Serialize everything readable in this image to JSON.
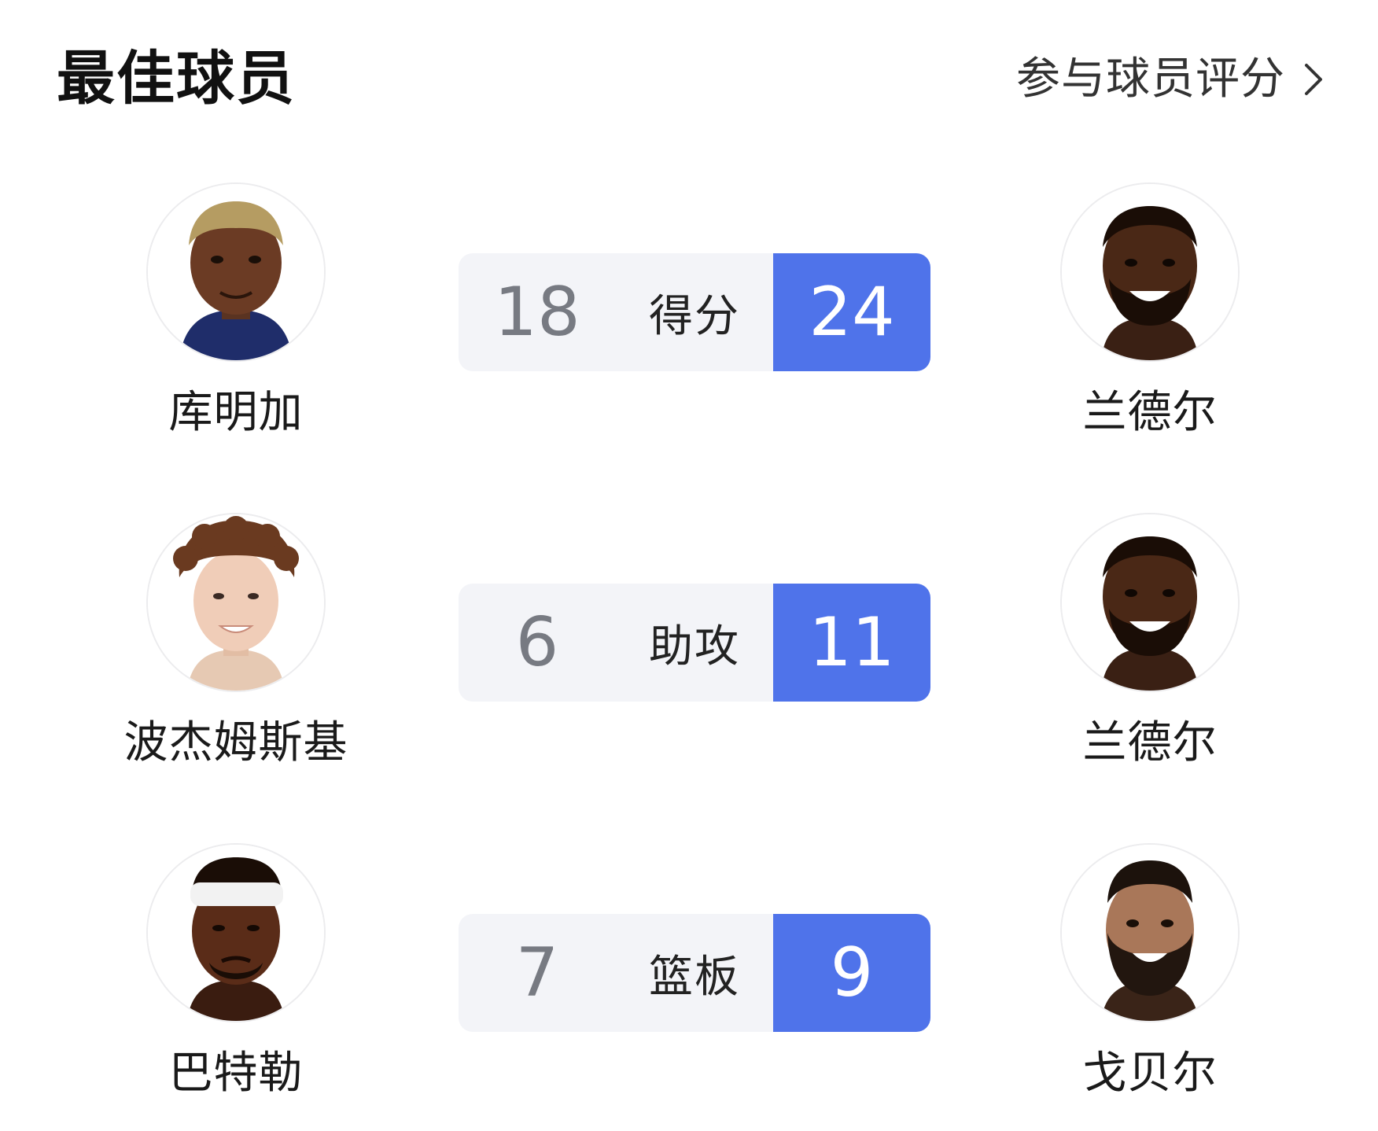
{
  "header": {
    "title": "最佳球员",
    "rate_link_label": "参与球员评分"
  },
  "colors": {
    "accent": "#4f73ea",
    "bar_bg": "#f3f4f8",
    "value_gray": "#777a82"
  },
  "rows": [
    {
      "category": "得分",
      "left_player": {
        "name": "库明加",
        "value": "18"
      },
      "right_player": {
        "name": "兰德尔",
        "value": "24"
      }
    },
    {
      "category": "助攻",
      "left_player": {
        "name": "波杰姆斯基",
        "value": "6"
      },
      "right_player": {
        "name": "兰德尔",
        "value": "11"
      }
    },
    {
      "category": "篮板",
      "left_player": {
        "name": "巴特勒",
        "value": "7"
      },
      "right_player": {
        "name": "戈贝尔",
        "value": "9"
      }
    }
  ]
}
